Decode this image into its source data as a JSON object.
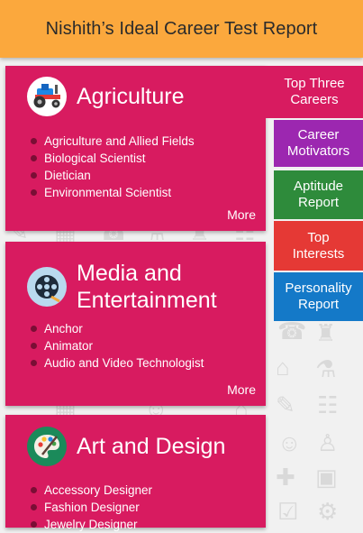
{
  "header": {
    "title": "Nishith’s Ideal Career Test Report"
  },
  "colors": {
    "header_bg": "#fba83d",
    "card_bg": "#d81b60",
    "tab_top_three": "#d81b60",
    "tab_motivators": "#9c27b0",
    "tab_aptitude": "#2e8b3b",
    "tab_interests": "#e53935",
    "tab_personality": "#1479c8"
  },
  "side_tabs": [
    {
      "label": "Top Three Careers",
      "icon": ""
    },
    {
      "label": "Career Motivators"
    },
    {
      "label": "Aptitude Report"
    },
    {
      "label": "Top Interests"
    },
    {
      "label": "Personality Report"
    }
  ],
  "cards": [
    {
      "title": "Agriculture",
      "icon": "tractor-icon",
      "items": [
        "Agriculture and Allied Fields",
        "Biological Scientist",
        "Dietician",
        "Environmental Scientist"
      ],
      "more_label": "More"
    },
    {
      "title_line1": "Media and",
      "title_line2": "Entertainment",
      "icon": "film-reel-icon",
      "items": [
        "Anchor",
        "Animator",
        "Audio and Video Technologist"
      ],
      "more_label": "More"
    },
    {
      "title": "Art and Design",
      "icon": "paint-palette-icon",
      "items": [
        "Accessory Designer",
        "Fashion Designer",
        "Jewelry Designer"
      ]
    }
  ]
}
